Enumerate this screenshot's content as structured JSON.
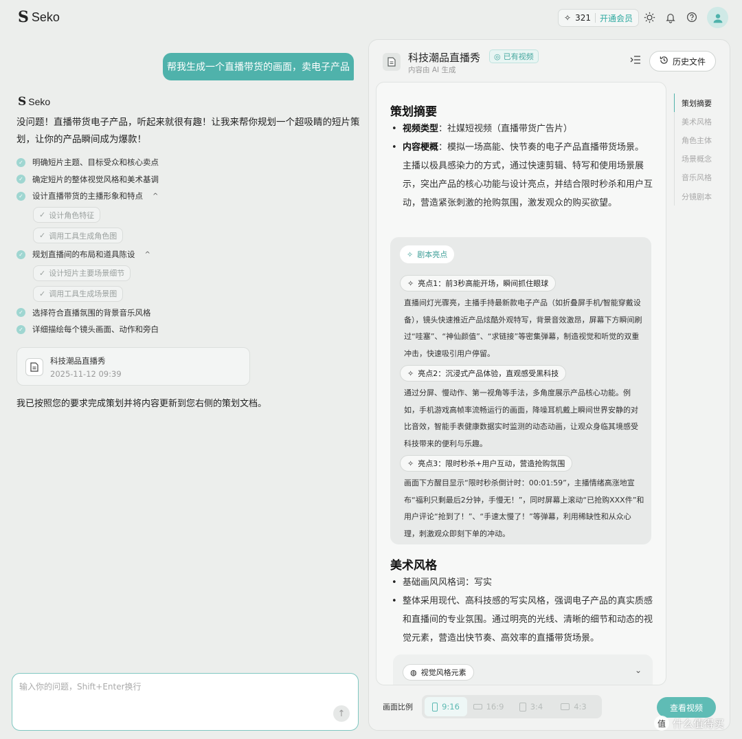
{
  "brand": {
    "name": "Seko"
  },
  "topbar": {
    "credits": "321",
    "vip_label": "开通会员"
  },
  "chat": {
    "user_message": "帮我生成一个直播带货的画面，卖电子产品",
    "bot_name": "Seko",
    "bot_intro": "没问题！直播带货电子产品，听起来就很有趣！让我来帮你规划一个超吸睛的短片策划，让你的产品瞬间成为爆款！",
    "steps": [
      {
        "label": "明确短片主题、目标受众和核心卖点"
      },
      {
        "label": "确定短片的整体视觉风格和美术基调"
      },
      {
        "label": "设计直播带货的主播形象和特点",
        "substeps": [
          "设计角色特征",
          "调用工具生成角色图"
        ]
      },
      {
        "label": "规划直播间的布局和道具陈设",
        "substeps": [
          "设计短片主要场景细节",
          "调用工具生成场景图"
        ]
      },
      {
        "label": "选择符合直播氛围的背景音乐风格"
      },
      {
        "label": "详细描绘每个镜头画面、动作和旁白"
      }
    ],
    "file_card": {
      "name": "科技潮品直播秀",
      "date": "2025-11-12 09:39"
    },
    "bot_done": "我已按照您的要求完成策划并将内容更新到您右侧的策划文档。",
    "input_placeholder": "输入你的问题，Shift+Enter换行"
  },
  "doc": {
    "title": "科技潮品直播秀",
    "badge": "已有视频",
    "subtitle": "内容由 AI 生成",
    "history_label": "历史文件",
    "summary_title": "策划摘要",
    "video_type_label": "视频类型",
    "video_type_value": "：社媒短视频（直播带货广告片）",
    "content_label": "内容梗概",
    "content_value": "：模拟一场高能、快节奏的电子产品直播带货场景。主播以极具感染力的方式，通过快速剪辑、特写和使用场景展示，突出产品的核心功能与设计亮点，并结合限时秒杀和用户互动，营造紧张刺激的抢购氛围，激发观众的购买欲望。",
    "highlight_tag": "剧本亮点",
    "highlights": [
      {
        "title": "亮点1：前3秒高能开场，瞬间抓住眼球",
        "text": "直播间灯光骤亮，主播手持最新款电子产品（如折叠屏手机/智能穿戴设备），镜头快速推近产品炫酷外观特写，背景音效激昂，屏幕下方瞬间刷过“哇塞”、“神仙颜值”、“求链接”等密集弹幕，制造视觉和听觉的双重冲击，快速吸引用户停留。"
      },
      {
        "title": "亮点2：沉浸式产品体验，直观感受黑科技",
        "text": "通过分屏、慢动作、第一视角等手法，多角度展示产品核心功能。例如，手机游戏高帧率流畅运行的画面，降噪耳机戴上瞬间世界安静的对比音效，智能手表健康数据实时监测的动态动画，让观众身临其境感受科技带来的便利与乐趣。"
      },
      {
        "title": "亮点3：限时秒杀+用户互动，营造抢购氛围",
        "text": "画面下方醒目显示“限时秒杀倒计时：00:01:59”，主播情绪高涨地宣布“福利只剩最后2分钟，手慢无！”，同时屏幕上滚动“已抢购XXX件”和用户评论“抢到了！”、“手速太慢了！”等弹幕，利用稀缺性和从众心理，刺激观众即刻下单的冲动。"
      }
    ],
    "art_title": "美术风格",
    "art_bullets": [
      "基础画风风格词：写实",
      "整体采用现代、高科技感的写实风格，强调电子产品的真实质感和直播间的专业氛围。通过明亮的光线、清晰的细节和动态的视觉元素，营造出快节奏、高效率的直播带货场景。"
    ],
    "visual_elements_label": "视觉风格元素",
    "outline": [
      "策划摘要",
      "美术风格",
      "角色主体",
      "场景概念",
      "音乐风格",
      "分镜剧本"
    ],
    "ratio_label": "画面比例",
    "ratios": [
      "9:16",
      "16:9",
      "3:4",
      "4:3"
    ],
    "view_video_label": "查看视频"
  },
  "watermark": {
    "text": "什么值得买",
    "badge": "值"
  }
}
